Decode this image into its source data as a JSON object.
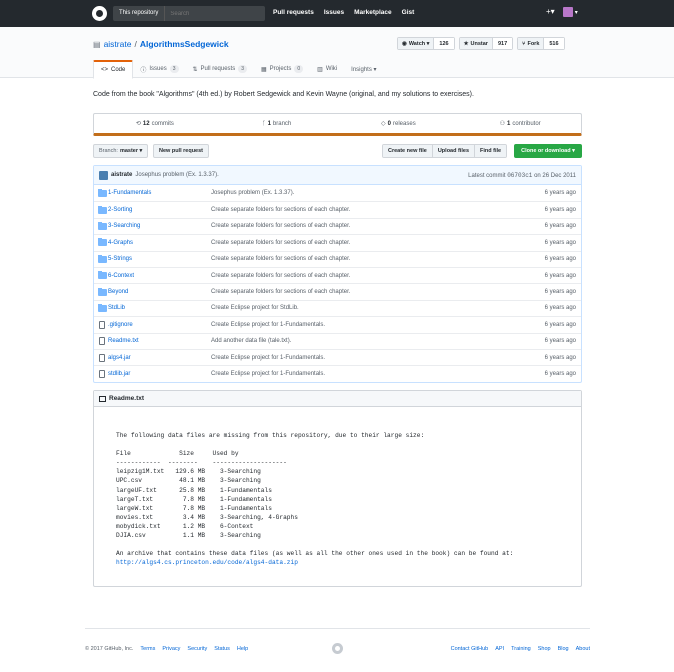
{
  "header": {
    "search_scope": "This repository",
    "search_placeholder": "Search",
    "nav": [
      "Pull requests",
      "Issues",
      "Marketplace",
      "Gist"
    ],
    "plus": "+▾",
    "avatar_caret": "▾"
  },
  "repo": {
    "owner": "aistrate",
    "separator": "/",
    "name": "AlgorithmsSedgewick",
    "watch_label": "Watch ▾",
    "watch_count": "126",
    "star_label": "Unstar",
    "star_count": "917",
    "fork_label": "Fork",
    "fork_count": "516"
  },
  "tabs": [
    {
      "label": "Code",
      "icon": "<>"
    },
    {
      "label": "Issues",
      "count": "3"
    },
    {
      "label": "Pull requests",
      "count": "3"
    },
    {
      "label": "Projects",
      "count": "0"
    },
    {
      "label": "Wiki"
    },
    {
      "label": "Insights ▾"
    }
  ],
  "description": "Code from the book \"Algorithms\" (4th ed.) by Robert Sedgewick and Kevin Wayne (original, and my solutions to exercises).",
  "summary": {
    "commits_count": "12",
    "commits_label": "commits",
    "branch_count": "1",
    "branch_label": "branch",
    "releases_count": "0",
    "releases_label": "releases",
    "contributor_count": "1",
    "contributor_label": "contributor"
  },
  "file_nav": {
    "branch_prefix": "Branch:",
    "branch_name": "master ▾",
    "new_pr": "New pull request",
    "create_file": "Create new file",
    "upload_files": "Upload files",
    "find_file": "Find file",
    "clone": "Clone or download ▾"
  },
  "commit": {
    "author": "aistrate",
    "message": "Josephus problem (Ex. 1.3.37).",
    "latest_prefix": "Latest commit",
    "sha": "06703c1",
    "date": "on 26 Dec 2011"
  },
  "files": [
    {
      "name": "1-Fundamentals",
      "type": "dir",
      "message": "Josephus problem (Ex. 1.3.37).",
      "age": "6 years ago"
    },
    {
      "name": "2-Sorting",
      "type": "dir",
      "message": "Create separate folders for sections of each chapter.",
      "age": "6 years ago"
    },
    {
      "name": "3-Searching",
      "type": "dir",
      "message": "Create separate folders for sections of each chapter.",
      "age": "6 years ago"
    },
    {
      "name": "4-Graphs",
      "type": "dir",
      "message": "Create separate folders for sections of each chapter.",
      "age": "6 years ago"
    },
    {
      "name": "5-Strings",
      "type": "dir",
      "message": "Create separate folders for sections of each chapter.",
      "age": "6 years ago"
    },
    {
      "name": "6-Context",
      "type": "dir",
      "message": "Create separate folders for sections of each chapter.",
      "age": "6 years ago"
    },
    {
      "name": "Beyond",
      "type": "dir",
      "message": "Create separate folders for sections of each chapter.",
      "age": "6 years ago"
    },
    {
      "name": "StdLib",
      "type": "dir",
      "message": "Create Eclipse project for StdLib.",
      "age": "6 years ago"
    },
    {
      "name": ".gitignore",
      "type": "file",
      "message": "Create Eclipse project for 1-Fundamentals.",
      "age": "6 years ago"
    },
    {
      "name": "Readme.txt",
      "type": "file",
      "message": "Add another data file (tale.txt).",
      "age": "6 years ago"
    },
    {
      "name": "algs4.jar",
      "type": "file",
      "message": "Create Eclipse project for 1-Fundamentals.",
      "age": "6 years ago"
    },
    {
      "name": "stdlib.jar",
      "type": "file",
      "message": "Create Eclipse project for 1-Fundamentals.",
      "age": "6 years ago"
    }
  ],
  "readme": {
    "title": "Readme.txt",
    "intro": "The following data files are missing from this repository, due to their large size:",
    "table_header": "File             Size     Used by",
    "table_rule": "------------  --------    --------------------",
    "lines": [
      "leipzig1M.txt   129.6 MB    3-Searching",
      "UPC.csv          48.1 MB    3-Searching",
      "largeUF.txt      25.8 MB    1-Fundamentals",
      "largeT.txt        7.8 MB    1-Fundamentals",
      "largeW.txt        7.8 MB    1-Fundamentals",
      "movies.txt        3.4 MB    3-Searching, 4-Graphs",
      "mobydick.txt      1.2 MB    6-Context",
      "DJIA.csv          1.1 MB    3-Searching"
    ],
    "archive_text": "An archive that contains these data files (as well as all the other ones used in the book) can be found at:",
    "archive_url": "http://algs4.cs.princeton.edu/code/algs4-data.zip"
  },
  "footer": {
    "copyright": "© 2017 GitHub, Inc.",
    "left_links": [
      "Terms",
      "Privacy",
      "Security",
      "Status",
      "Help"
    ],
    "right_links": [
      "Contact GitHub",
      "API",
      "Training",
      "Shop",
      "Blog",
      "About"
    ]
  }
}
